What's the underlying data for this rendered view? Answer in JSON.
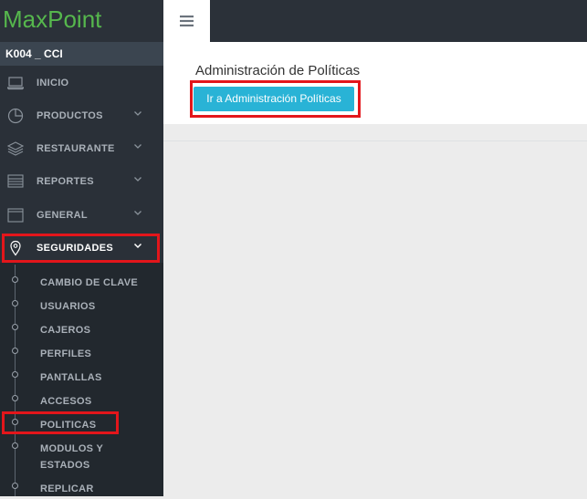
{
  "app": {
    "logo": "MaxPoint",
    "user_label": "K004 _ CCI"
  },
  "sidebar": {
    "items": [
      {
        "label": "INICIO",
        "icon": "laptop-icon",
        "has_chevron": false
      },
      {
        "label": "PRODUCTOS",
        "icon": "pie-chart-icon",
        "has_chevron": true
      },
      {
        "label": "RESTAURANTE",
        "icon": "layers-icon",
        "has_chevron": true
      },
      {
        "label": "REPORTES",
        "icon": "table-icon",
        "has_chevron": true
      },
      {
        "label": "GENERAL",
        "icon": "window-icon",
        "has_chevron": true
      },
      {
        "label": "SEGURIDADES",
        "icon": "map-pin-icon",
        "has_chevron": true,
        "active": true
      }
    ],
    "sub_items": [
      {
        "label": "CAMBIO DE CLAVE"
      },
      {
        "label": "USUARIOS"
      },
      {
        "label": "CAJEROS"
      },
      {
        "label": "PERFILES"
      },
      {
        "label": "PANTALLAS"
      },
      {
        "label": "ACCESOS"
      },
      {
        "label": "POLITICAS",
        "highlighted": true
      },
      {
        "label_line1": "MODULOS Y",
        "label_line2": "ESTADOS"
      },
      {
        "label": "REPLICAR"
      }
    ]
  },
  "main": {
    "title": "Administración de Políticas",
    "button_label": "Ir a Administración Políticas"
  },
  "colors": {
    "sidebar_bg": "#2a3038",
    "logo_green": "#56b74d",
    "button_blue": "#29b3d6",
    "highlight_red": "#e3161b"
  }
}
